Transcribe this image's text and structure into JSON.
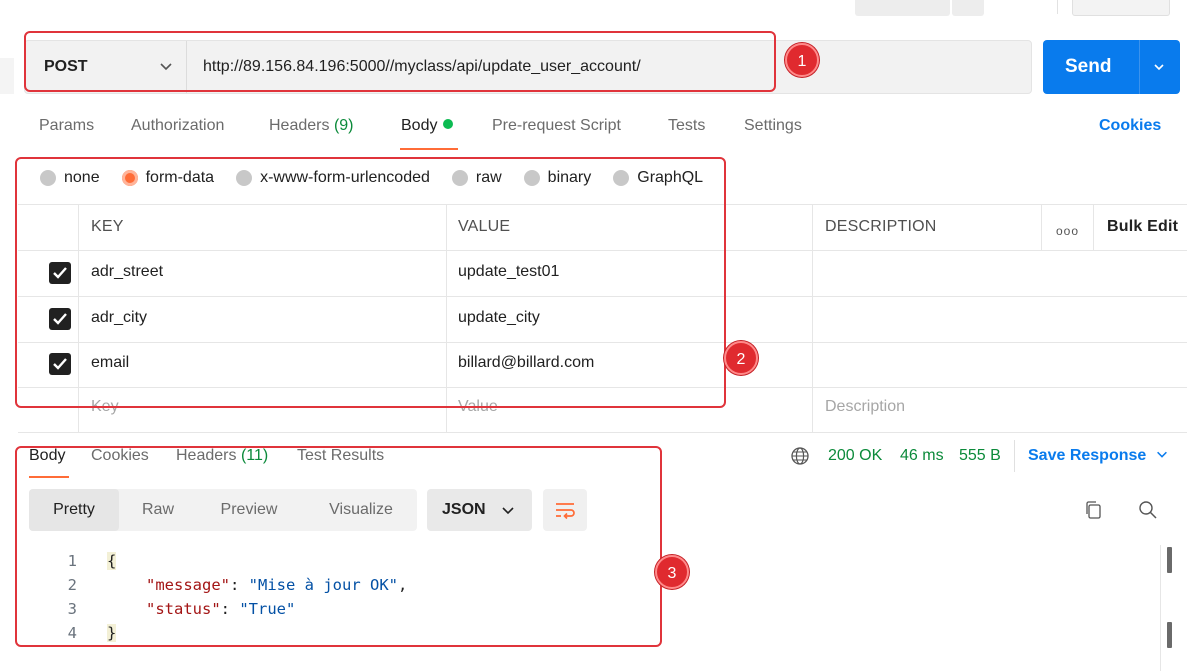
{
  "request": {
    "method": "POST",
    "url": "http://89.156.84.196:5000//myclass/api/update_user_account/",
    "send_label": "Send"
  },
  "request_tabs": {
    "params": "Params",
    "authorization": "Authorization",
    "headers": "Headers",
    "headers_count": "(9)",
    "body": "Body",
    "pre_request": "Pre-request Script",
    "tests": "Tests",
    "settings": "Settings",
    "cookies": "Cookies"
  },
  "body_types": {
    "none": "none",
    "form_data": "form-data",
    "urlencoded": "x-www-form-urlencoded",
    "raw": "raw",
    "binary": "binary",
    "graphql": "GraphQL"
  },
  "params_table": {
    "headers": {
      "key": "KEY",
      "value": "VALUE",
      "description": "DESCRIPTION",
      "more": "ooo",
      "bulk_edit": "Bulk Edit"
    },
    "rows": [
      {
        "key": "adr_street",
        "value": "update_test01",
        "checked": true
      },
      {
        "key": "adr_city",
        "value": "update_city",
        "checked": true
      },
      {
        "key": "email",
        "value": "billard@billard.com",
        "checked": true
      }
    ],
    "placeholders": {
      "key": "Key",
      "value": "Value",
      "description": "Description"
    }
  },
  "response_tabs": {
    "body": "Body",
    "cookies": "Cookies",
    "headers": "Headers",
    "headers_count": "(11)",
    "test_results": "Test Results"
  },
  "response_status": {
    "status": "200 OK",
    "time": "46 ms",
    "size": "555 B",
    "save": "Save Response"
  },
  "response_view": {
    "pretty": "Pretty",
    "raw": "Raw",
    "preview": "Preview",
    "visualize": "Visualize",
    "format": "JSON"
  },
  "response_code": {
    "line_numbers": [
      "1",
      "2",
      "3",
      "4"
    ],
    "open_brace": "{",
    "close_brace": "}",
    "message_key": "\"message\"",
    "message_value": "\"Mise à jour OK\"",
    "status_key": "\"status\"",
    "status_value": "\"True\""
  },
  "annotations": {
    "one": "1",
    "two": "2",
    "three": "3"
  },
  "colors": {
    "accent_orange": "#ff6c37",
    "send_blue": "#097bed",
    "status_green": "#0b8a3a",
    "annotation_red": "#e0343b"
  },
  "icons": [
    "chevron-down-icon",
    "checkbox-checked-icon",
    "globe-icon",
    "wrap-lines-icon",
    "copy-icon",
    "search-icon"
  ]
}
